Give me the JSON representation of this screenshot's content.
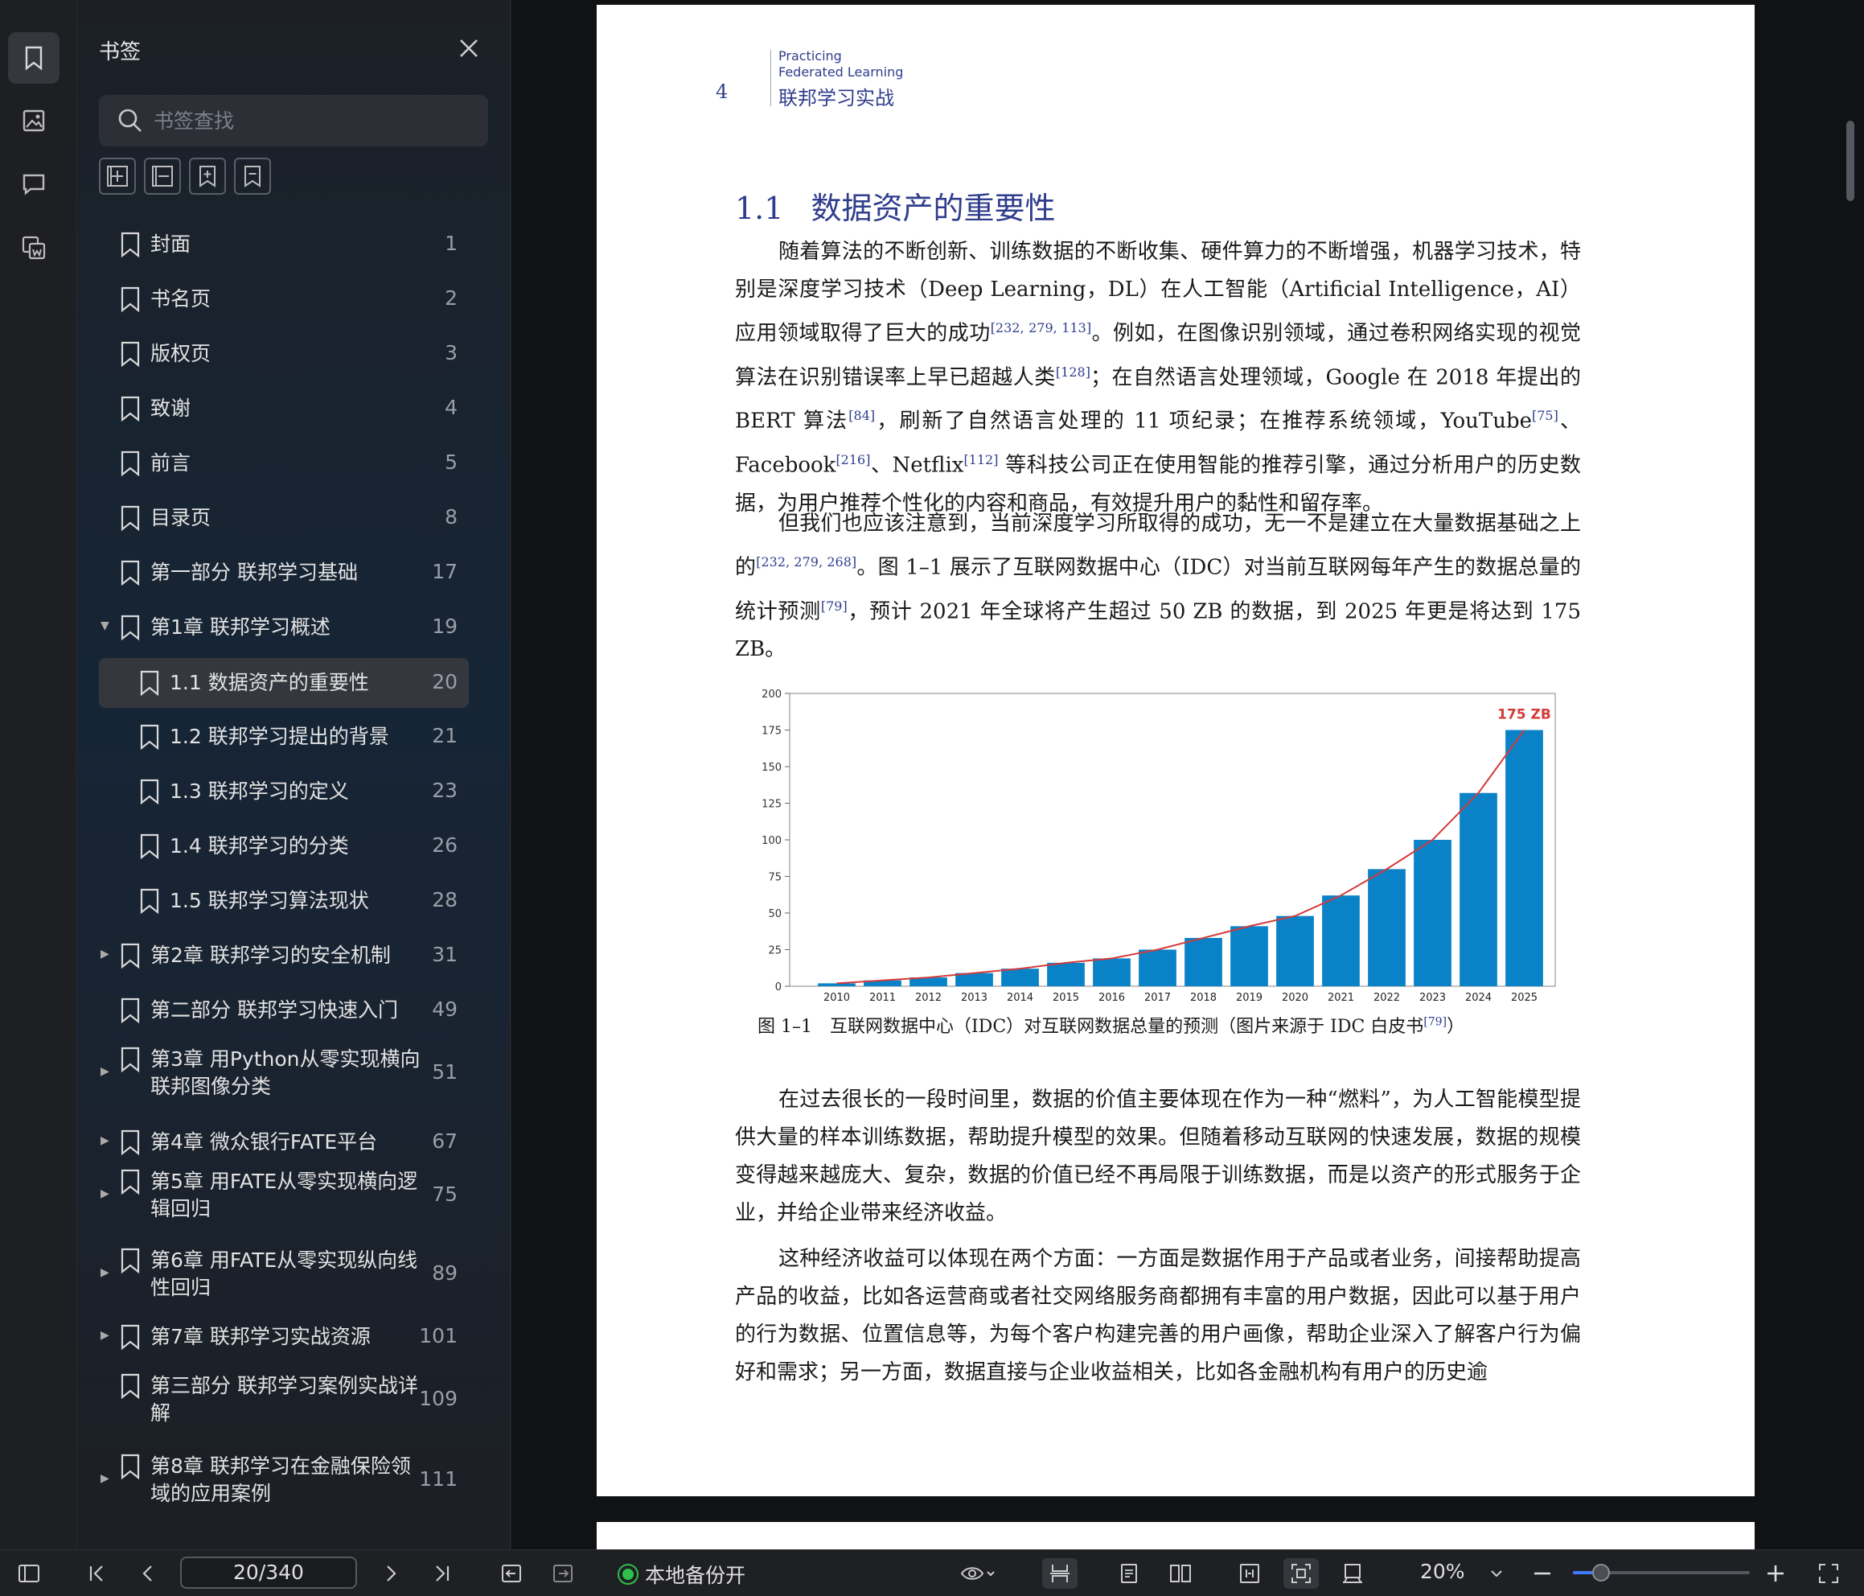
{
  "panel": {
    "title": "书签",
    "search_placeholder": "书签查找"
  },
  "bookmarks": [
    {
      "label": "封面",
      "page": "1",
      "indent": 0,
      "arrow": "",
      "active": false
    },
    {
      "label": "书名页",
      "page": "2",
      "indent": 0,
      "arrow": "",
      "active": false
    },
    {
      "label": "版权页",
      "page": "3",
      "indent": 0,
      "arrow": "",
      "active": false
    },
    {
      "label": "致谢",
      "page": "4",
      "indent": 0,
      "arrow": "",
      "active": false
    },
    {
      "label": "前言",
      "page": "5",
      "indent": 0,
      "arrow": "",
      "active": false
    },
    {
      "label": "目录页",
      "page": "8",
      "indent": 0,
      "arrow": "",
      "active": false
    },
    {
      "label": "第一部分 联邦学习基础",
      "page": "17",
      "indent": 0,
      "arrow": "",
      "active": false
    },
    {
      "label": "第1章 联邦学习概述",
      "page": "19",
      "indent": 0,
      "arrow": "▼",
      "active": false
    },
    {
      "label": "1.1 数据资产的重要性",
      "page": "20",
      "indent": 1,
      "arrow": "",
      "active": true
    },
    {
      "label": "1.2 联邦学习提出的背景",
      "page": "21",
      "indent": 1,
      "arrow": "",
      "active": false
    },
    {
      "label": "1.3 联邦学习的定义",
      "page": "23",
      "indent": 1,
      "arrow": "",
      "active": false
    },
    {
      "label": "1.4 联邦学习的分类",
      "page": "26",
      "indent": 1,
      "arrow": "",
      "active": false
    },
    {
      "label": "1.5 联邦学习算法现状",
      "page": "28",
      "indent": 1,
      "arrow": "",
      "active": false
    },
    {
      "label": "第2章 联邦学习的安全机制",
      "page": "31",
      "indent": 0,
      "arrow": "▶",
      "active": false
    },
    {
      "label": "第二部分 联邦学习快速入门",
      "page": "49",
      "indent": 0,
      "arrow": "",
      "active": false
    },
    {
      "label": "第3章 用Python从零实现横向\n联邦图像分类",
      "page": "51",
      "indent": 0,
      "arrow": "▶",
      "active": false
    },
    {
      "label": "第4章 微众银行FATE平台",
      "page": "67",
      "indent": 0,
      "arrow": "▶",
      "active": false
    },
    {
      "label": "第5章 用FATE从零实现横向逻\n辑回归",
      "page": "75",
      "indent": 0,
      "arrow": "▶",
      "active": false
    },
    {
      "label": "第6章 用FATE从零实现纵向线\n性回归",
      "page": "89",
      "indent": 0,
      "arrow": "▶",
      "active": false
    },
    {
      "label": "第7章 联邦学习实战资源",
      "page": "101",
      "indent": 0,
      "arrow": "▶",
      "active": false
    },
    {
      "label": "第三部分 联邦学习案例实战详\n解",
      "page": "109",
      "indent": 0,
      "arrow": "",
      "active": false
    },
    {
      "label": "第8章 联邦学习在金融保险领\n域的应用案例",
      "page": "111",
      "indent": 0,
      "arrow": "▶",
      "active": false
    }
  ],
  "document": {
    "page_number": "4",
    "running_en_1": "Practicing",
    "running_en_2": "Federated Learning",
    "running_cn": "联邦学习实战",
    "section_num": "1.1",
    "section_title": "数据资产的重要性",
    "caption": "图 1–1　互联网数据中心（IDC）对互联网数据总量的预测（图片来源于 IDC 白皮书",
    "caption_ref": "[79]",
    "caption_end": "）"
  },
  "chart_data": {
    "type": "bar",
    "categories": [
      "2010",
      "2011",
      "2012",
      "2013",
      "2014",
      "2015",
      "2016",
      "2017",
      "2018",
      "2019",
      "2020",
      "2021",
      "2022",
      "2023",
      "2024",
      "2025"
    ],
    "values": [
      2,
      4,
      6,
      9,
      12,
      16,
      19,
      25,
      33,
      41,
      48,
      62,
      80,
      100,
      132,
      175
    ],
    "ylim": [
      0,
      200
    ],
    "yticks": [
      "0",
      "25",
      "50",
      "75",
      "100",
      "125",
      "150",
      "175",
      "200"
    ],
    "annotation": "175 ZB",
    "bar_color": "#0a82c8",
    "trend_color": "#d43a3a"
  },
  "toolbar": {
    "page_indicator": "20/340",
    "backup_label": "本地备份开",
    "zoom_label": "20%"
  },
  "colors": {
    "accent": "#2f3d8c",
    "backup_dot": "#2fbf4a",
    "slider": "#3d7bff"
  }
}
